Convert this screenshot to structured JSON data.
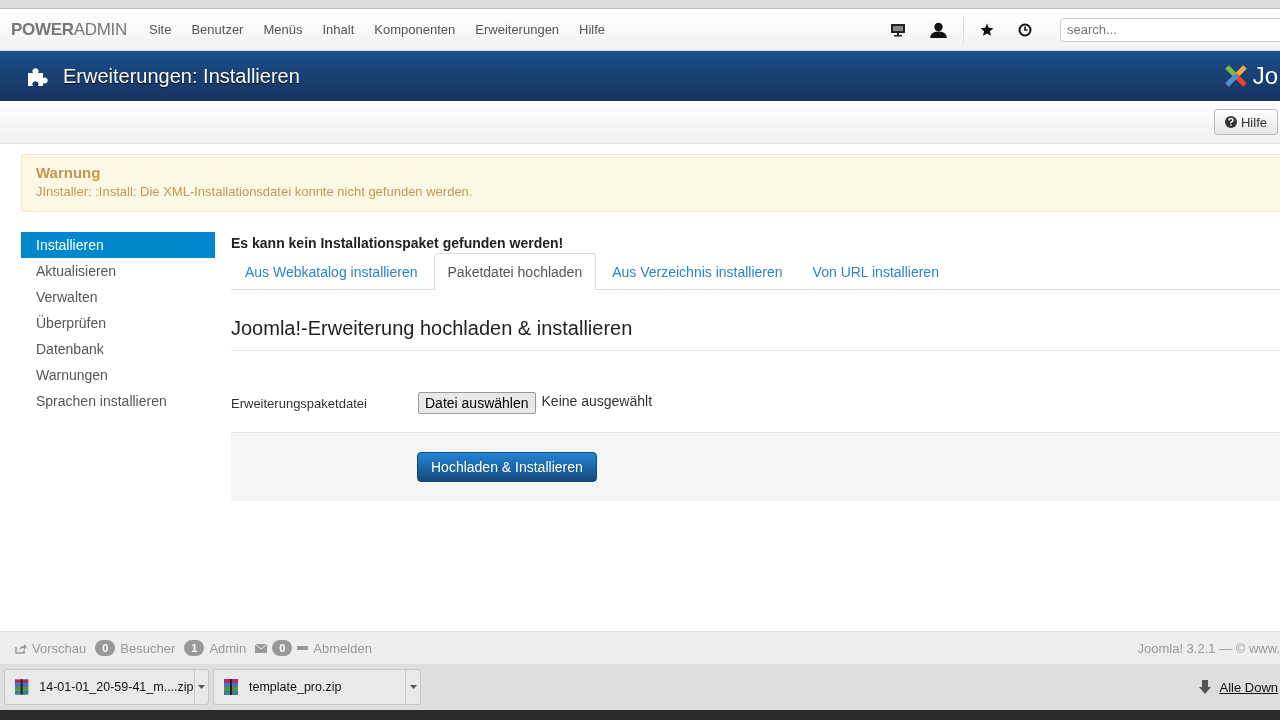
{
  "navbar": {
    "brand_bold": "POWER",
    "brand_light": "ADMIN",
    "menu": [
      "Site",
      "Benutzer",
      "Menüs",
      "Inhalt",
      "Komponenten",
      "Erweiterungen",
      "Hilfe"
    ],
    "search": {
      "placeholder": "search..."
    }
  },
  "header": {
    "title": "Erweiterungen: Installieren",
    "logo_text": "Jo"
  },
  "toolbar": {
    "help_button": "Hilfe"
  },
  "alert": {
    "title": "Warnung",
    "message": "JInstaller: :Install: Die XML-Installationsdatei konnte nicht gefunden werden."
  },
  "sidebar": {
    "items": [
      {
        "label": "Installieren",
        "selected": true
      },
      {
        "label": "Aktualisieren",
        "selected": false
      },
      {
        "label": "Verwalten",
        "selected": false
      },
      {
        "label": "Überprüfen",
        "selected": false
      },
      {
        "label": "Datenbank",
        "selected": false
      },
      {
        "label": "Warnungen",
        "selected": false
      },
      {
        "label": "Sprachen installieren",
        "selected": false
      }
    ]
  },
  "main": {
    "error": "Es kann kein Installationspaket gefunden werden!",
    "tabs": [
      {
        "label": "Aus Webkatalog installieren",
        "selected": false
      },
      {
        "label": "Paketdatei hochladen",
        "selected": true
      },
      {
        "label": "Aus Verzeichnis installieren",
        "selected": false
      },
      {
        "label": "Von URL installieren",
        "selected": false
      }
    ],
    "heading": "Joomla!-Erweiterung hochladen & installieren",
    "field_label": "Erweiterungspaketdatei",
    "file_button": "Datei auswählen",
    "file_status": "Keine ausgewählt",
    "submit": "Hochladen & Installieren"
  },
  "status_bar": {
    "preview": "Vorschau",
    "visitors_count": "0",
    "visitors": "Besucher",
    "admin_count": "1",
    "admin": "Admin",
    "messages_count": "0",
    "logout": "Abmelden",
    "version": "Joomla! 3.2.1 — © www."
  },
  "downloads": {
    "items": [
      "14-01-01_20-59-41_m....zip",
      "template_pro.zip"
    ],
    "show_all": "Alle Down"
  }
}
